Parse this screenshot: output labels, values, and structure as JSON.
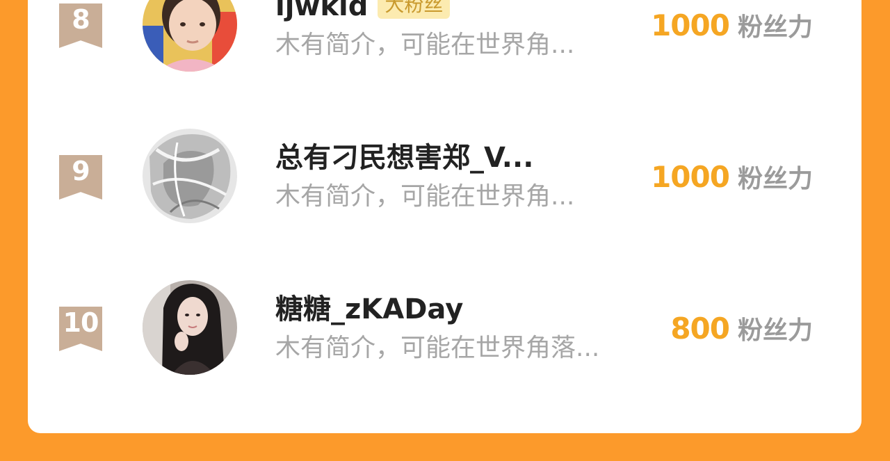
{
  "rows": [
    {
      "rank": "8",
      "name": "ljwkid",
      "badge": "大粉丝",
      "bio": "木有简介，可能在世界角...",
      "score": "1000",
      "unit": "粉丝力",
      "avatar_icon": "child-photo-avatar"
    },
    {
      "rank": "9",
      "name": "总有刁民想害郑_V...",
      "badge": "",
      "bio": "木有简介，可能在世界角...",
      "score": "1000",
      "unit": "粉丝力",
      "avatar_icon": "sketch-art-avatar"
    },
    {
      "rank": "10",
      "name": "糖糖_zKADay",
      "badge": "",
      "bio": "木有简介，可能在世界角落...",
      "score": "800",
      "unit": "粉丝力",
      "avatar_icon": "woman-photo-avatar"
    }
  ],
  "colors": {
    "background": "#FC9A2B",
    "card": "#FFFFFF",
    "rank_ribbon": "#C9AE97",
    "score": "#F5A623",
    "unit": "#9B9B9B",
    "badge_bg": "#FCEBB0",
    "badge_text": "#C99A2E"
  }
}
